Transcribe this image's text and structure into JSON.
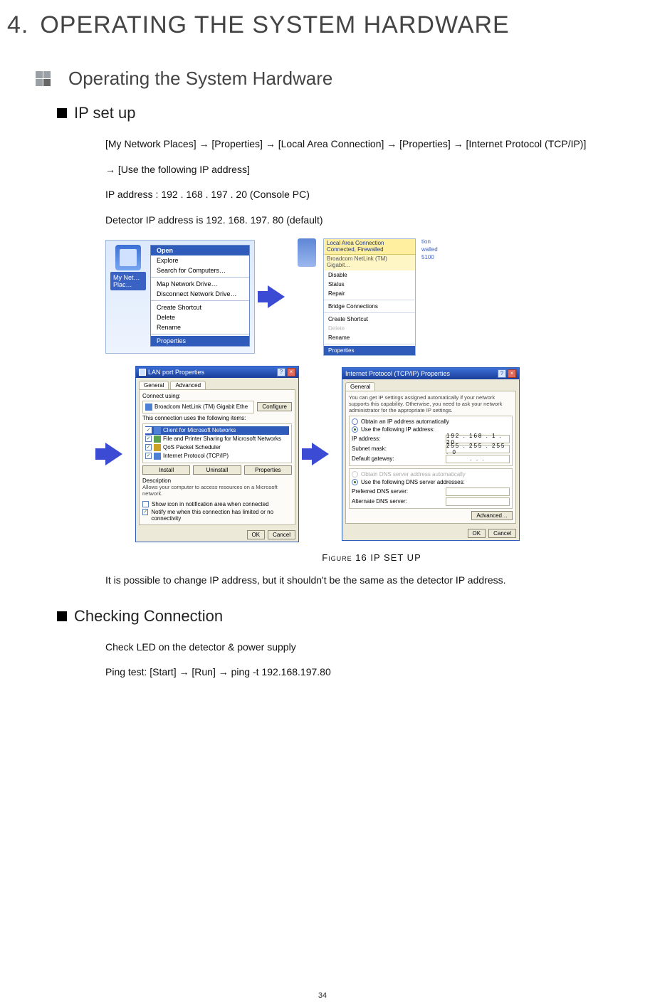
{
  "chapter": {
    "number": "4.",
    "title_html": "OPERATING THE SYSTEM HARDWARE"
  },
  "section": {
    "title": "Operating the System Hardware"
  },
  "sub1": {
    "title": "IP set up",
    "p1": "[My Network Places] → [Properties] → [Local Area Connection] → [Properties] → [Internet Protocol (TCP/IP)]",
    "p2": "→ [Use the following IP address]",
    "p3": "IP address : 192 . 168 . 197 . 20  (Console PC)",
    "p4": "Detector IP address is 192. 168. 197. 80 (default)",
    "caption": "Figure 16  IP SET UP",
    "note": "It is possible to change IP address, but it shouldn't be the same as the detector IP address."
  },
  "ctx1": {
    "iconLabel": "My Net… Plac…",
    "open": "Open",
    "explore": "Explore",
    "search": "Search for Computers…",
    "map": "Map Network Drive…",
    "disc": "Disconnect Network Drive…",
    "shortcut": "Create Shortcut",
    "delete": "Delete",
    "rename": "Rename",
    "props": "Properties"
  },
  "ctx2": {
    "banner": "Local Area Connection\nConnected, Firewalled",
    "bannerSub": "Broadcom NetLink (TM) Gigabit…",
    "disable": "Disable",
    "status": "Status",
    "repair": "Repair",
    "bridge": "Bridge Connections",
    "shortcut": "Create Shortcut",
    "delete": "Delete",
    "rename": "Rename",
    "props": "Properties",
    "sideTop": "tion",
    "sideMid": "walled",
    "sideBot": "5100"
  },
  "dlgLan": {
    "title": "LAN port Properties",
    "tabGeneral": "General",
    "tabAdvanced": "Advanced",
    "connectUsing": "Connect using:",
    "adapter": "Broadcom NetLink (TM) Gigabit Ethe",
    "configure": "Configure",
    "usesItems": "This connection uses the following items:",
    "item1": "Client for Microsoft Networks",
    "item2": "File and Printer Sharing for Microsoft Networks",
    "item3": "QoS Packet Scheduler",
    "item4": "Internet Protocol (TCP/IP)",
    "install": "Install",
    "uninstall": "Uninstall",
    "properties": "Properties",
    "descHead": "Description",
    "desc": "Allows your computer to access resources on a Microsoft network.",
    "showIcon": "Show icon in notification area when connected",
    "notify": "Notify me when this connection has limited or no connectivity",
    "ok": "OK",
    "cancel": "Cancel"
  },
  "dlgIp": {
    "title": "Internet Protocol (TCP/IP) Properties",
    "tabGeneral": "General",
    "intro": "You can get IP settings assigned automatically if your network supports this capability. Otherwise, you need to ask your network administrator for the appropriate IP settings.",
    "optAuto": "Obtain an IP address automatically",
    "optManual": "Use the following IP address:",
    "ipLabel": "IP address:",
    "ipVal": "192 . 168 .   1 .  20",
    "maskLabel": "Subnet mask:",
    "maskVal": "255 . 255 . 255 .   0",
    "gwLabel": "Default gateway:",
    "gwVal": " . . . ",
    "dnsAuto": "Obtain DNS server address automatically",
    "dnsManual": "Use the following DNS server addresses:",
    "dns1Label": "Preferred DNS server:",
    "dns2Label": "Alternate DNS server:",
    "advanced": "Advanced…",
    "ok": "OK",
    "cancel": "Cancel"
  },
  "sub2": {
    "title": "Checking Connection",
    "p1": "Check LED on the detector & power supply",
    "p2": "Ping test: [Start] → [Run] → ping -t 192.168.197.80"
  },
  "pageNumber": "34"
}
